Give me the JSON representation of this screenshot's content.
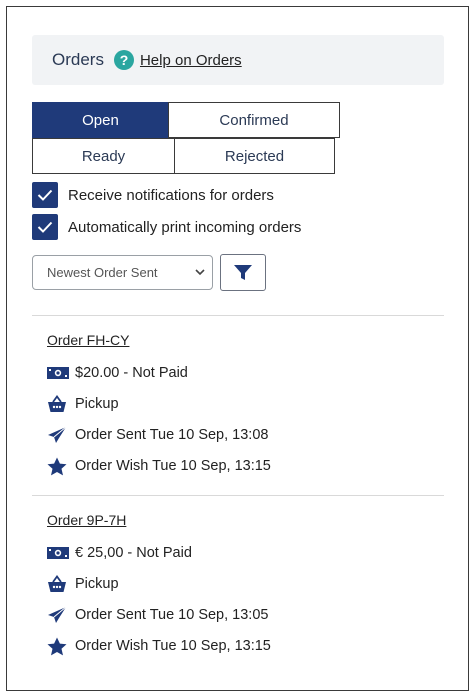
{
  "header": {
    "title": "Orders",
    "help_icon_glyph": "?",
    "help_link": "Help on Orders"
  },
  "tabs": [
    {
      "label": "Open",
      "active": true
    },
    {
      "label": "Confirmed",
      "active": false
    },
    {
      "label": "Ready",
      "active": false
    },
    {
      "label": "Rejected",
      "active": false
    }
  ],
  "options": {
    "notifications_label": "Receive notifications for orders",
    "notifications_checked": true,
    "autoprint_label": "Automatically print incoming orders",
    "autoprint_checked": true
  },
  "sort": {
    "selected": "Newest Order Sent",
    "icon": "chevron-down-icon"
  },
  "filter": {
    "icon": "funnel-icon"
  },
  "orders": [
    {
      "id": "Order FH-CY",
      "payment": "$20.00 - Not Paid",
      "method": "Pickup",
      "sent": "Order Sent Tue 10 Sep, 13:08",
      "wish": "Order Wish Tue 10 Sep, 13:15"
    },
    {
      "id": "Order 9P-7H",
      "payment": "€ 25,00 - Not Paid",
      "method": "Pickup",
      "sent": "Order Sent Tue 10 Sep, 13:05",
      "wish": "Order Wish Tue 10 Sep, 13:15"
    }
  ],
  "colors": {
    "primary": "#1f3a7a",
    "help_icon": "#2aa6a0",
    "header_bg": "#f1f3f5"
  }
}
